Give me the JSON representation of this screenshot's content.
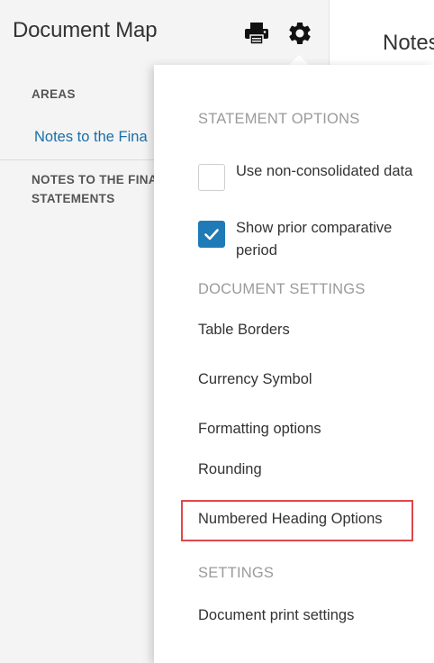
{
  "sidebar": {
    "title": "Document Map",
    "areas_heading": "AREAS",
    "areas_link": "Notes to the Fina",
    "notes_heading": "NOTES TO THE FINA STATEMENTS"
  },
  "toolbar": {
    "print_icon": "printer-icon",
    "settings_icon": "gear-icon"
  },
  "main": {
    "title": "Notes"
  },
  "dropdown": {
    "statement_heading": "STATEMENT OPTIONS",
    "options": [
      {
        "label": "Use non-consolidated data",
        "checked": false
      },
      {
        "label": "Show prior comparative period",
        "checked": true
      }
    ],
    "document_heading": "DOCUMENT SETTINGS",
    "document_items": [
      "Table Borders",
      "Currency Symbol",
      "Formatting options",
      "Rounding",
      "Numbered Heading Options"
    ],
    "settings_heading": "SETTINGS",
    "settings_items": [
      "Document print settings"
    ]
  },
  "colors": {
    "accent": "#1f7ab8",
    "link": "#1a6ea8",
    "highlight": "#e0474c"
  }
}
